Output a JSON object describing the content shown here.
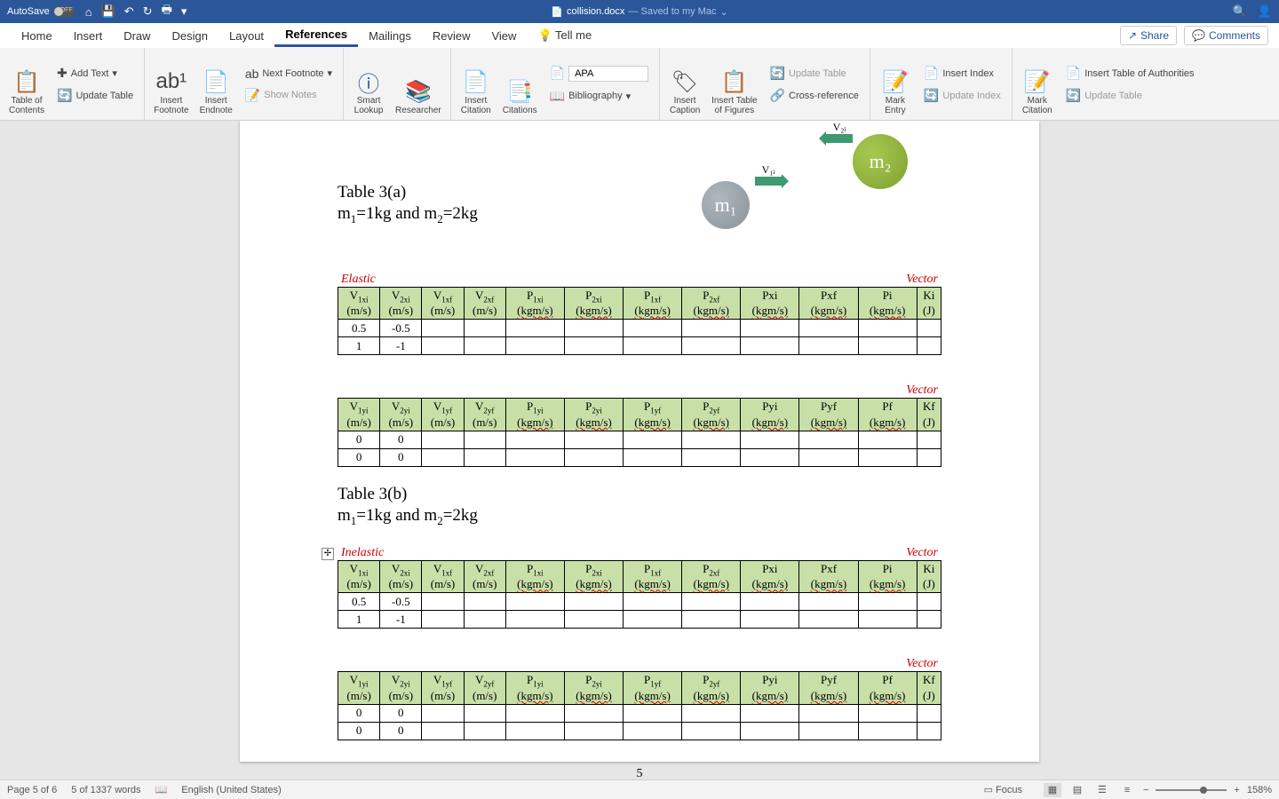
{
  "titlebar": {
    "autosave": "AutoSave",
    "autosave_state": "OFF",
    "filename": "collision.docx",
    "saved": "— Saved to my Mac"
  },
  "menu": {
    "tabs": [
      "Home",
      "Insert",
      "Draw",
      "Design",
      "Layout",
      "References",
      "Mailings",
      "Review",
      "View",
      "Tell me"
    ],
    "active": 5,
    "share": "Share",
    "comments": "Comments"
  },
  "ribbon": {
    "toc": "Table of\nContents",
    "add_text": "Add Text",
    "update_table": "Update Table",
    "insert_footnote": "Insert\nFootnote",
    "insert_endnote": "Insert\nEndnote",
    "next_footnote": "Next Footnote",
    "show_notes": "Show Notes",
    "smart_lookup": "Smart\nLookup",
    "researcher": "Researcher",
    "insert_citation": "Insert\nCitation",
    "citations": "Citations",
    "style_value": "APA",
    "bibliography": "Bibliography",
    "insert_caption": "Insert\nCaption",
    "insert_tof": "Insert Table\nof Figures",
    "update_table2": "Update Table",
    "cross_ref": "Cross-reference",
    "mark_entry": "Mark\nEntry",
    "insert_index": "Insert Index",
    "update_index": "Update Index",
    "mark_citation": "Mark\nCitation",
    "insert_toa": "Insert Table of Authorities",
    "update_table3": "Update Table"
  },
  "doc": {
    "table3a": "Table 3(a)",
    "table3b": "Table 3(b)",
    "masses": "m₁=1kg and m₂=2kg",
    "elastic": "Elastic",
    "inelastic": "Inelastic",
    "vector": "Vector",
    "v1i": "V₁ᵢ",
    "v2i": "V₂ᵢ",
    "m1": "m₁",
    "m2": "m₂",
    "page_num": "5"
  },
  "chart_data": [
    {
      "type": "table",
      "title": "Table 3(a) Elastic x-components",
      "columns": [
        "V1xi (m/s)",
        "V2xi (m/s)",
        "V1xf (m/s)",
        "V2xf (m/s)",
        "P1xi (kgm/s)",
        "P2xi (kgm/s)",
        "P1xf (kgm/s)",
        "P2xf (kgm/s)",
        "Pxi (kgm/s)",
        "Pxf (kgm/s)",
        "Pi (kgm/s)",
        "Ki (J)"
      ],
      "rows": [
        [
          "0.5",
          "-0.5",
          "",
          "",
          "",
          "",
          "",
          "",
          "",
          "",
          "",
          ""
        ],
        [
          "1",
          "-1",
          "",
          "",
          "",
          "",
          "",
          "",
          "",
          "",
          "",
          ""
        ]
      ]
    },
    {
      "type": "table",
      "title": "Table 3(a) Elastic y-components",
      "columns": [
        "V1yi (m/s)",
        "V2yi (m/s)",
        "V1yf (m/s)",
        "V2yf (m/s)",
        "P1yi (kgm/s)",
        "P2yi (kgm/s)",
        "P1yf (kgm/s)",
        "P2yf (kgm/s)",
        "Pyi (kgm/s)",
        "Pyf (kgm/s)",
        "Pf (kgm/s)",
        "Kf (J)"
      ],
      "rows": [
        [
          "0",
          "0",
          "",
          "",
          "",
          "",
          "",
          "",
          "",
          "",
          "",
          ""
        ],
        [
          "0",
          "0",
          "",
          "",
          "",
          "",
          "",
          "",
          "",
          "",
          "",
          ""
        ]
      ]
    },
    {
      "type": "table",
      "title": "Table 3(b) Inelastic x-components",
      "columns": [
        "V1xi (m/s)",
        "V2xi (m/s)",
        "V1xf (m/s)",
        "V2xf (m/s)",
        "P1xi (kgm/s)",
        "P2xi (kgm/s)",
        "P1xf (kgm/s)",
        "P2xf (kgm/s)",
        "Pxi (kgm/s)",
        "Pxf (kgm/s)",
        "Pi (kgm/s)",
        "Ki (J)"
      ],
      "rows": [
        [
          "0.5",
          "-0.5",
          "",
          "",
          "",
          "",
          "",
          "",
          "",
          "",
          "",
          ""
        ],
        [
          "1",
          "-1",
          "",
          "",
          "",
          "",
          "",
          "",
          "",
          "",
          "",
          ""
        ]
      ]
    },
    {
      "type": "table",
      "title": "Table 3(b) Inelastic y-components",
      "columns": [
        "V1yi (m/s)",
        "V2yi (m/s)",
        "V1yf (m/s)",
        "V2yf (m/s)",
        "P1yi (kgm/s)",
        "P2yi (kgm/s)",
        "P1yf (kgm/s)",
        "P2yf (kgm/s)",
        "Pyi (kgm/s)",
        "Pyf (kgm/s)",
        "Pf (kgm/s)",
        "Kf (J)"
      ],
      "rows": [
        [
          "0",
          "0",
          "",
          "",
          "",
          "",
          "",
          "",
          "",
          "",
          "",
          ""
        ],
        [
          "0",
          "0",
          "",
          "",
          "",
          "",
          "",
          "",
          "",
          "",
          "",
          ""
        ]
      ]
    }
  ],
  "status": {
    "page": "Page 5 of 6",
    "words": "5 of 1337 words",
    "lang": "English (United States)",
    "focus": "Focus",
    "zoom": "158%"
  }
}
